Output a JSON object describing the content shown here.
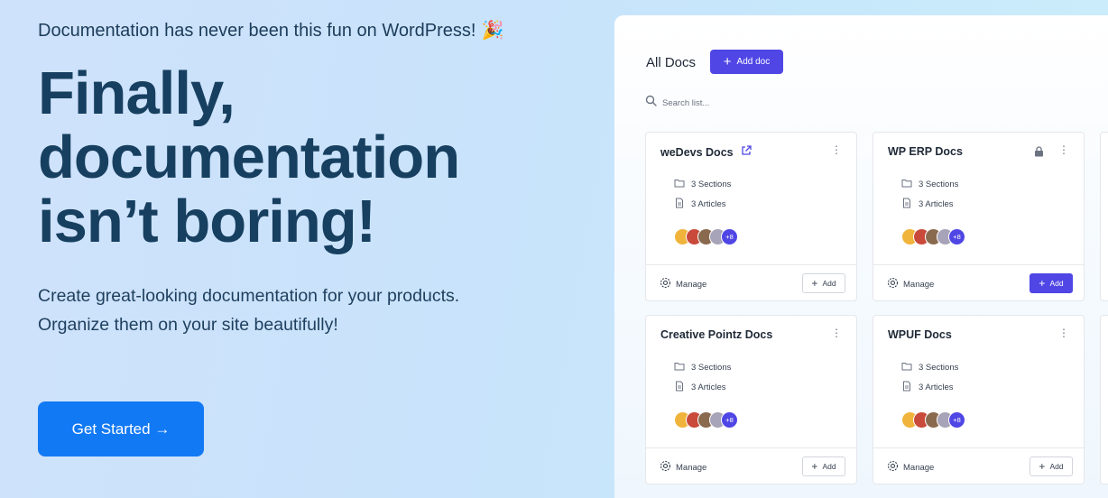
{
  "hero": {
    "tagline": "Documentation has never been this fun on WordPress!",
    "tagline_icon": "party-popper-icon",
    "headline_lines": [
      "Finally,",
      "documentation",
      "isn’t boring!"
    ],
    "subtitle": "Create great-looking documentation for your products. Organize them on your site beautifully!",
    "cta_label": "Get Started →"
  },
  "panel": {
    "title": "All Docs",
    "add_doc_label": "Add doc",
    "search_placeholder": "Search list...",
    "cards": [
      {
        "title": "weDevs Docs",
        "title_icon": "external-link-icon",
        "sections": "3 Sections",
        "articles": "3 Articles",
        "more_count": "+8",
        "manage_label": "Manage",
        "add_label": "Add",
        "add_active": false
      },
      {
        "title": "WP ERP Docs",
        "title_icon": "lock-icon",
        "sections": "3 Sections",
        "articles": "3 Articles",
        "more_count": "+8",
        "manage_label": "Manage",
        "add_label": "Add",
        "add_active": true
      },
      {
        "title": "Creative Pointz Docs",
        "sections": "3 Sections",
        "articles": "3 Articles",
        "more_count": "+8",
        "manage_label": "Manage",
        "add_label": "Add",
        "add_active": false
      },
      {
        "title": "WPUF Docs",
        "sections": "3 Sections",
        "articles": "3 Articles",
        "more_count": "+8",
        "manage_label": "Manage",
        "add_label": "Add",
        "add_active": false
      }
    ]
  },
  "colors": {
    "cta": "#1279f4",
    "accent": "#4f46e5",
    "heading": "#173f60"
  }
}
